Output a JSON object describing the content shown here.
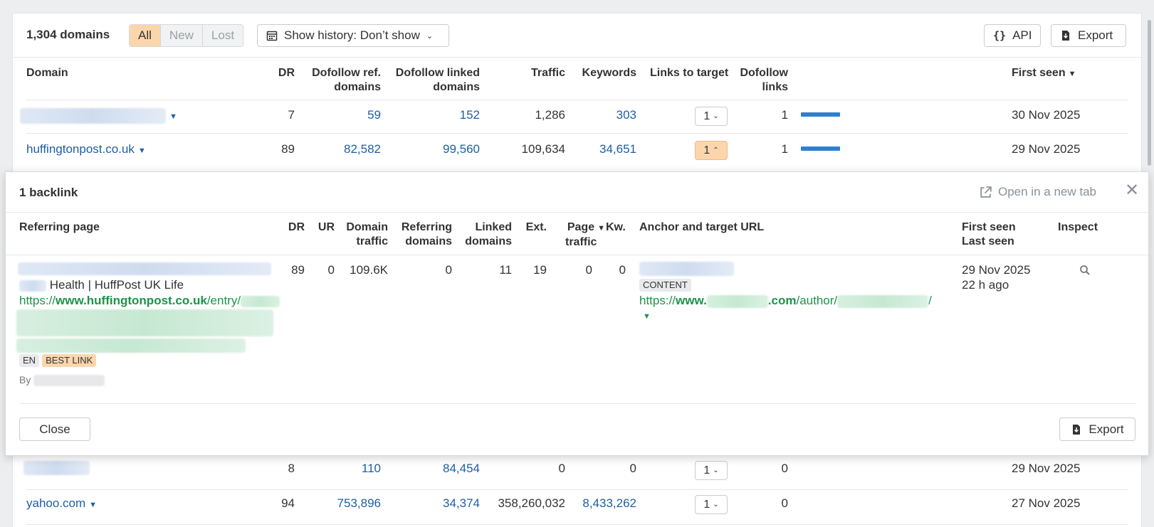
{
  "toolbar": {
    "domains_count": "1,304 domains",
    "filters": [
      "All",
      "New",
      "Lost"
    ],
    "history_label": "Show history: Don’t show",
    "api_label": "API",
    "export_label": "Export"
  },
  "table": {
    "headers": {
      "domain": "Domain",
      "dr": "DR",
      "dofollow_ref_domains_1": "Dofollow ref.",
      "dofollow_ref_domains_2": "domains",
      "dofollow_linked_1": "Dofollow linked",
      "dofollow_linked_2": "domains",
      "traffic": "Traffic",
      "keywords": "Keywords",
      "links_to_target": "Links to target",
      "dofollow_links_1": "Dofollow",
      "dofollow_links_2": "links",
      "first_seen": "First seen"
    },
    "rows": [
      {
        "domain": "",
        "dr": "7",
        "ref_domains": "59",
        "linked_domains": "152",
        "traffic": "1,286",
        "keywords": "303",
        "links": "1",
        "dofollow_links": "1",
        "first_seen": "30 Nov 2025",
        "dofollow_ratio": 1.0
      },
      {
        "domain": "huffingtonpost.co.uk",
        "dr": "89",
        "ref_domains": "82,582",
        "linked_domains": "99,560",
        "traffic": "109,634",
        "keywords": "34,651",
        "links": "1",
        "dofollow_links": "1",
        "first_seen": "29 Nov 2025",
        "dofollow_ratio": 1.0
      },
      {
        "domain": "",
        "dr": "8",
        "ref_domains": "110",
        "linked_domains": "84,454",
        "traffic": "0",
        "keywords": "0",
        "links": "1",
        "dofollow_links": "0",
        "first_seen": "29 Nov 2025",
        "dofollow_ratio": 0
      },
      {
        "domain": "yahoo.com",
        "dr": "94",
        "ref_domains": "753,896",
        "linked_domains": "34,374",
        "traffic": "358,260,032",
        "keywords": "8,433,262",
        "links": "1",
        "dofollow_links": "0",
        "first_seen": "27 Nov 2025",
        "dofollow_ratio": 0
      }
    ]
  },
  "popover": {
    "title": "1 backlink",
    "open_new_tab": "Open in a new tab",
    "headers": {
      "referring_page": "Referring page",
      "dr": "DR",
      "ur": "UR",
      "domain_traffic_1": "Domain",
      "domain_traffic_2": "traffic",
      "referring_domains_1": "Referring",
      "referring_domains_2": "domains",
      "linked_domains_1": "Linked",
      "linked_domains_2": "domains",
      "ext": "Ext.",
      "page_traffic_1": "Page",
      "page_traffic_2": "traffic",
      "kw": "Kw.",
      "anchor": "Anchor and target URL",
      "first_seen": "First seen",
      "last_seen": "Last seen",
      "inspect": "Inspect"
    },
    "row": {
      "title_visible": "Health | HuffPost UK Life",
      "url_prefix": "https://",
      "url_host": "www.huffingtonpost.co.uk",
      "url_path": "/entry/",
      "lang_tag": "EN",
      "best_tag": "BEST LINK",
      "by_label": "By",
      "dr": "89",
      "ur": "0",
      "domain_traffic": "109.6K",
      "referring_domains": "0",
      "linked_domains": "11",
      "ext": "19",
      "page_traffic": "0",
      "kw": "0",
      "anchor_tag": "CONTENT",
      "target_prefix": "https://",
      "target_host_start": "www.",
      "target_host_end": ".com",
      "target_path": "/author/",
      "target_slash": "/",
      "first_seen": "29 Nov 2025",
      "last_seen": "22 h ago"
    },
    "close_label": "Close",
    "export_label": "Export"
  },
  "colors": {
    "accent_orange": "#fbd6ad",
    "link_blue": "#1d5ea8",
    "bar_blue": "#2e7fd1",
    "url_green": "#1a9448"
  }
}
